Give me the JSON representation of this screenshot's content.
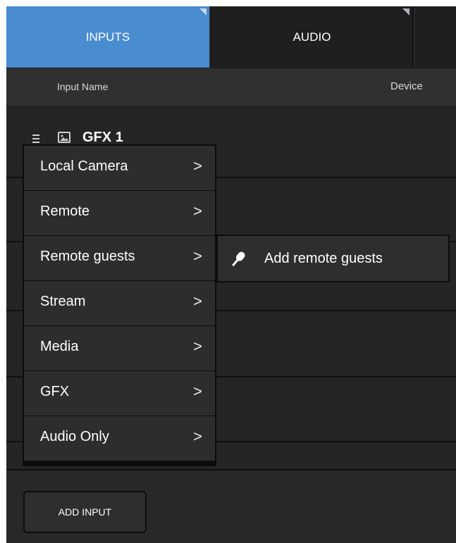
{
  "tabs": [
    {
      "label": "INPUTS",
      "active": true
    },
    {
      "label": "AUDIO",
      "active": false
    }
  ],
  "columns": {
    "input_name": "Input Name",
    "device": "Device"
  },
  "inputs": [
    {
      "name": "GFX 1",
      "icon": "image-icon"
    }
  ],
  "menu": {
    "items": [
      {
        "label": "Local Camera",
        "chevron": ">"
      },
      {
        "label": "Remote",
        "chevron": ">"
      },
      {
        "label": "Remote guests",
        "chevron": ">"
      },
      {
        "label": "Stream",
        "chevron": ">"
      },
      {
        "label": "Media",
        "chevron": ">"
      },
      {
        "label": "GFX",
        "chevron": ">"
      },
      {
        "label": "Audio Only",
        "chevron": ">"
      }
    ],
    "submenu": {
      "label": "Add remote guests",
      "icon": "microphone-icon"
    }
  },
  "footer": {
    "add_input_label": "ADD INPUT"
  },
  "colors": {
    "accent": "#4a8cd0",
    "panel": "#262626",
    "menu": "#2d2d2d"
  }
}
